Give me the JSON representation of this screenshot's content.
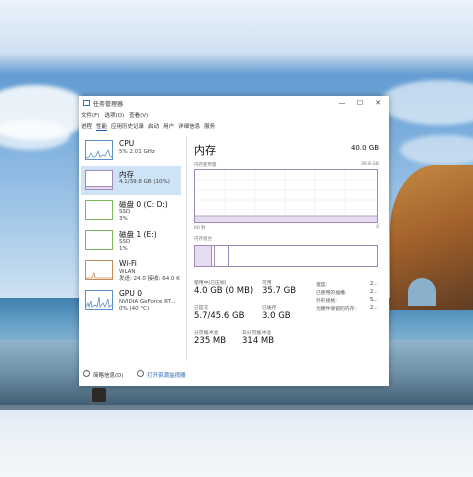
{
  "window": {
    "title": "任务管理器",
    "minimize": "—",
    "maximize": "☐",
    "close": "✕"
  },
  "menu": [
    "文件(F)",
    "选项(O)",
    "查看(V)"
  ],
  "tabs": [
    "进程",
    "性能",
    "应用历史记录",
    "启动",
    "用户",
    "详细信息",
    "服务"
  ],
  "sidebar": {
    "items": [
      {
        "name": "CPU",
        "detail1": "5% 2.01 GHz",
        "detail2": ""
      },
      {
        "name": "内存",
        "detail1": "4.1/39.8 GB (10%)",
        "detail2": ""
      },
      {
        "name": "磁盘 0 (C: D:)",
        "detail1": "SSD",
        "detail2": "3%"
      },
      {
        "name": "磁盘 1 (E:)",
        "detail1": "SSD",
        "detail2": "1%"
      },
      {
        "name": "Wi-Fi",
        "detail1": "WLAN",
        "detail2": "发送: 24.0 接收: 64.0 K"
      },
      {
        "name": "GPU 0",
        "detail1": "NVIDIA GeForce RT...",
        "detail2": "0% (40 °C)"
      }
    ]
  },
  "main": {
    "title": "内存",
    "capacity": "40.0 GB",
    "usage_label": "内存使用量",
    "usage_max": "39.8 GB",
    "axis_left": "60 秒",
    "axis_right": "0",
    "composition_label": "内存组合",
    "stats": {
      "in_use_label": "使用中(已压缩)",
      "in_use_value": "4.0 GB (0 MB)",
      "available_label": "可用",
      "available_value": "35.7 GB",
      "committed_label": "已提交",
      "committed_value": "5.7/45.6 GB",
      "cached_label": "已缓存",
      "cached_value": "3.0 GB",
      "paged_label": "分页缓冲池",
      "paged_value": "235 MB",
      "nonpaged_label": "非分页缓冲池",
      "nonpaged_value": "314 MB"
    },
    "right_stats": [
      {
        "label": "速度:",
        "value": "2..."
      },
      {
        "label": "已使用的插槽:",
        "value": "2..."
      },
      {
        "label": "外形规格:",
        "value": "S..."
      },
      {
        "label": "为硬件保留的内存:",
        "value": "2..."
      }
    ]
  },
  "footer": {
    "brief": "简略信息(D)",
    "resmon": "打开资源监视器"
  },
  "colors": {
    "accent": "#9e8ab8",
    "cpu_graph": "#5b8fc9",
    "selected": "#cfe3f6",
    "link": "#1a5fb4"
  }
}
